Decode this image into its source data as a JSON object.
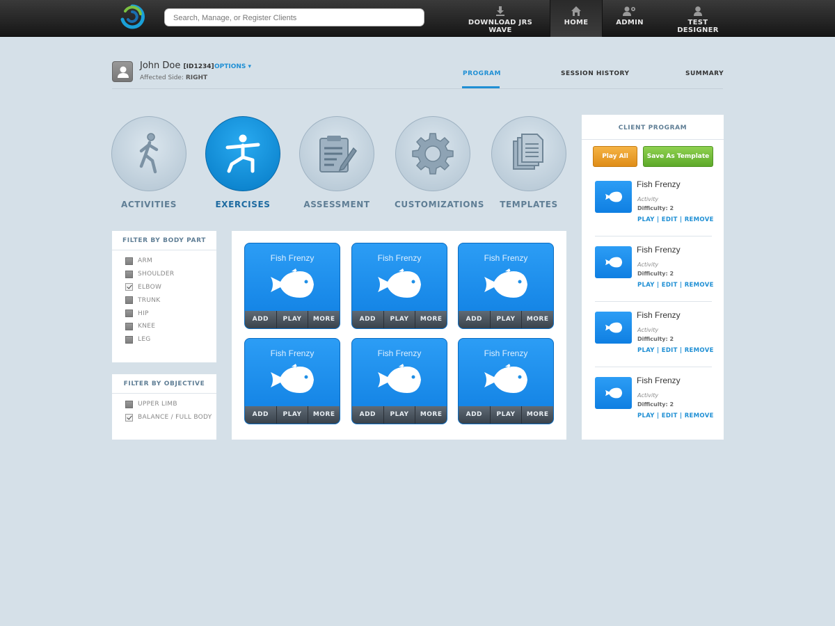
{
  "topbar": {
    "search_placeholder": "Search, Manage, or Register Clients",
    "nav": [
      {
        "label": "DOWNLOAD JRS WAVE",
        "icon": "download-icon"
      },
      {
        "label": "HOME",
        "icon": "home-icon",
        "active": true
      },
      {
        "label": "ADMIN",
        "icon": "admin-users-icon"
      },
      {
        "label": "TEST DESIGNER",
        "icon": "user-icon"
      }
    ]
  },
  "client": {
    "name": "John Doe",
    "id": "[ID1234]",
    "options_label": "OPTIONS",
    "affected_side_label": "Affected Side:",
    "affected_side_value": "RIGHT"
  },
  "tabs": [
    {
      "label": "PROGRAM",
      "active": true
    },
    {
      "label": "SESSION HISTORY"
    },
    {
      "label": "SUMMARY"
    }
  ],
  "categories": [
    {
      "label": "ACTIVITIES",
      "icon": "running-person-icon"
    },
    {
      "label": "EXERCISES",
      "icon": "exercise-person-icon",
      "active": true
    },
    {
      "label": "ASSESSMENT",
      "icon": "clipboard-icon"
    },
    {
      "label": "CUSTOMIZATIONS",
      "icon": "gear-icon"
    },
    {
      "label": "TEMPLATES",
      "icon": "documents-icon"
    }
  ],
  "filters": {
    "body_part": {
      "title": "FILTER BY BODY PART",
      "items": [
        {
          "label": "ARM",
          "checked": false
        },
        {
          "label": "SHOULDER",
          "checked": false
        },
        {
          "label": "ELBOW",
          "checked": true
        },
        {
          "label": "TRUNK",
          "checked": false
        },
        {
          "label": "HIP",
          "checked": false
        },
        {
          "label": "KNEE",
          "checked": false
        },
        {
          "label": "LEG",
          "checked": false
        }
      ]
    },
    "objective": {
      "title": "FILTER BY OBJECTIVE",
      "items": [
        {
          "label": "UPPER LIMB",
          "checked": false
        },
        {
          "label": "BALANCE / FULL BODY",
          "checked": true
        }
      ]
    }
  },
  "tiles": {
    "buttons": {
      "add": "ADD",
      "play": "PLAY",
      "more": "MORE"
    },
    "items": [
      {
        "title": "Fish Frenzy"
      },
      {
        "title": "Fish Frenzy"
      },
      {
        "title": "Fish Frenzy"
      },
      {
        "title": "Fish Frenzy"
      },
      {
        "title": "Fish Frenzy"
      },
      {
        "title": "Fish Frenzy"
      }
    ]
  },
  "program": {
    "title": "CLIENT PROGRAM",
    "play_all": "Play All",
    "save_template": "Save As Template",
    "items": [
      {
        "name": "Fish Frenzy",
        "type": "Activity",
        "difficulty": "Difficulty: 2",
        "play": "PLAY",
        "edit": "EDIT",
        "remove": "REMOVE"
      },
      {
        "name": "Fish Frenzy",
        "type": "Activity",
        "difficulty": "Difficulty: 2",
        "play": "PLAY",
        "edit": "EDIT",
        "remove": "REMOVE"
      },
      {
        "name": "Fish Frenzy",
        "type": "Activity",
        "difficulty": "Difficulty: 2",
        "play": "PLAY",
        "edit": "EDIT",
        "remove": "REMOVE"
      },
      {
        "name": "Fish Frenzy",
        "type": "Activity",
        "difficulty": "Difficulty: 2",
        "play": "PLAY",
        "edit": "EDIT",
        "remove": "REMOVE"
      }
    ]
  },
  "colors": {
    "accent": "#1f8fd4",
    "tile_blue": "#1a8cea",
    "play_all_orange": "#e9a02d",
    "save_template_green": "#72bb38",
    "background": "#d5e0e8"
  }
}
